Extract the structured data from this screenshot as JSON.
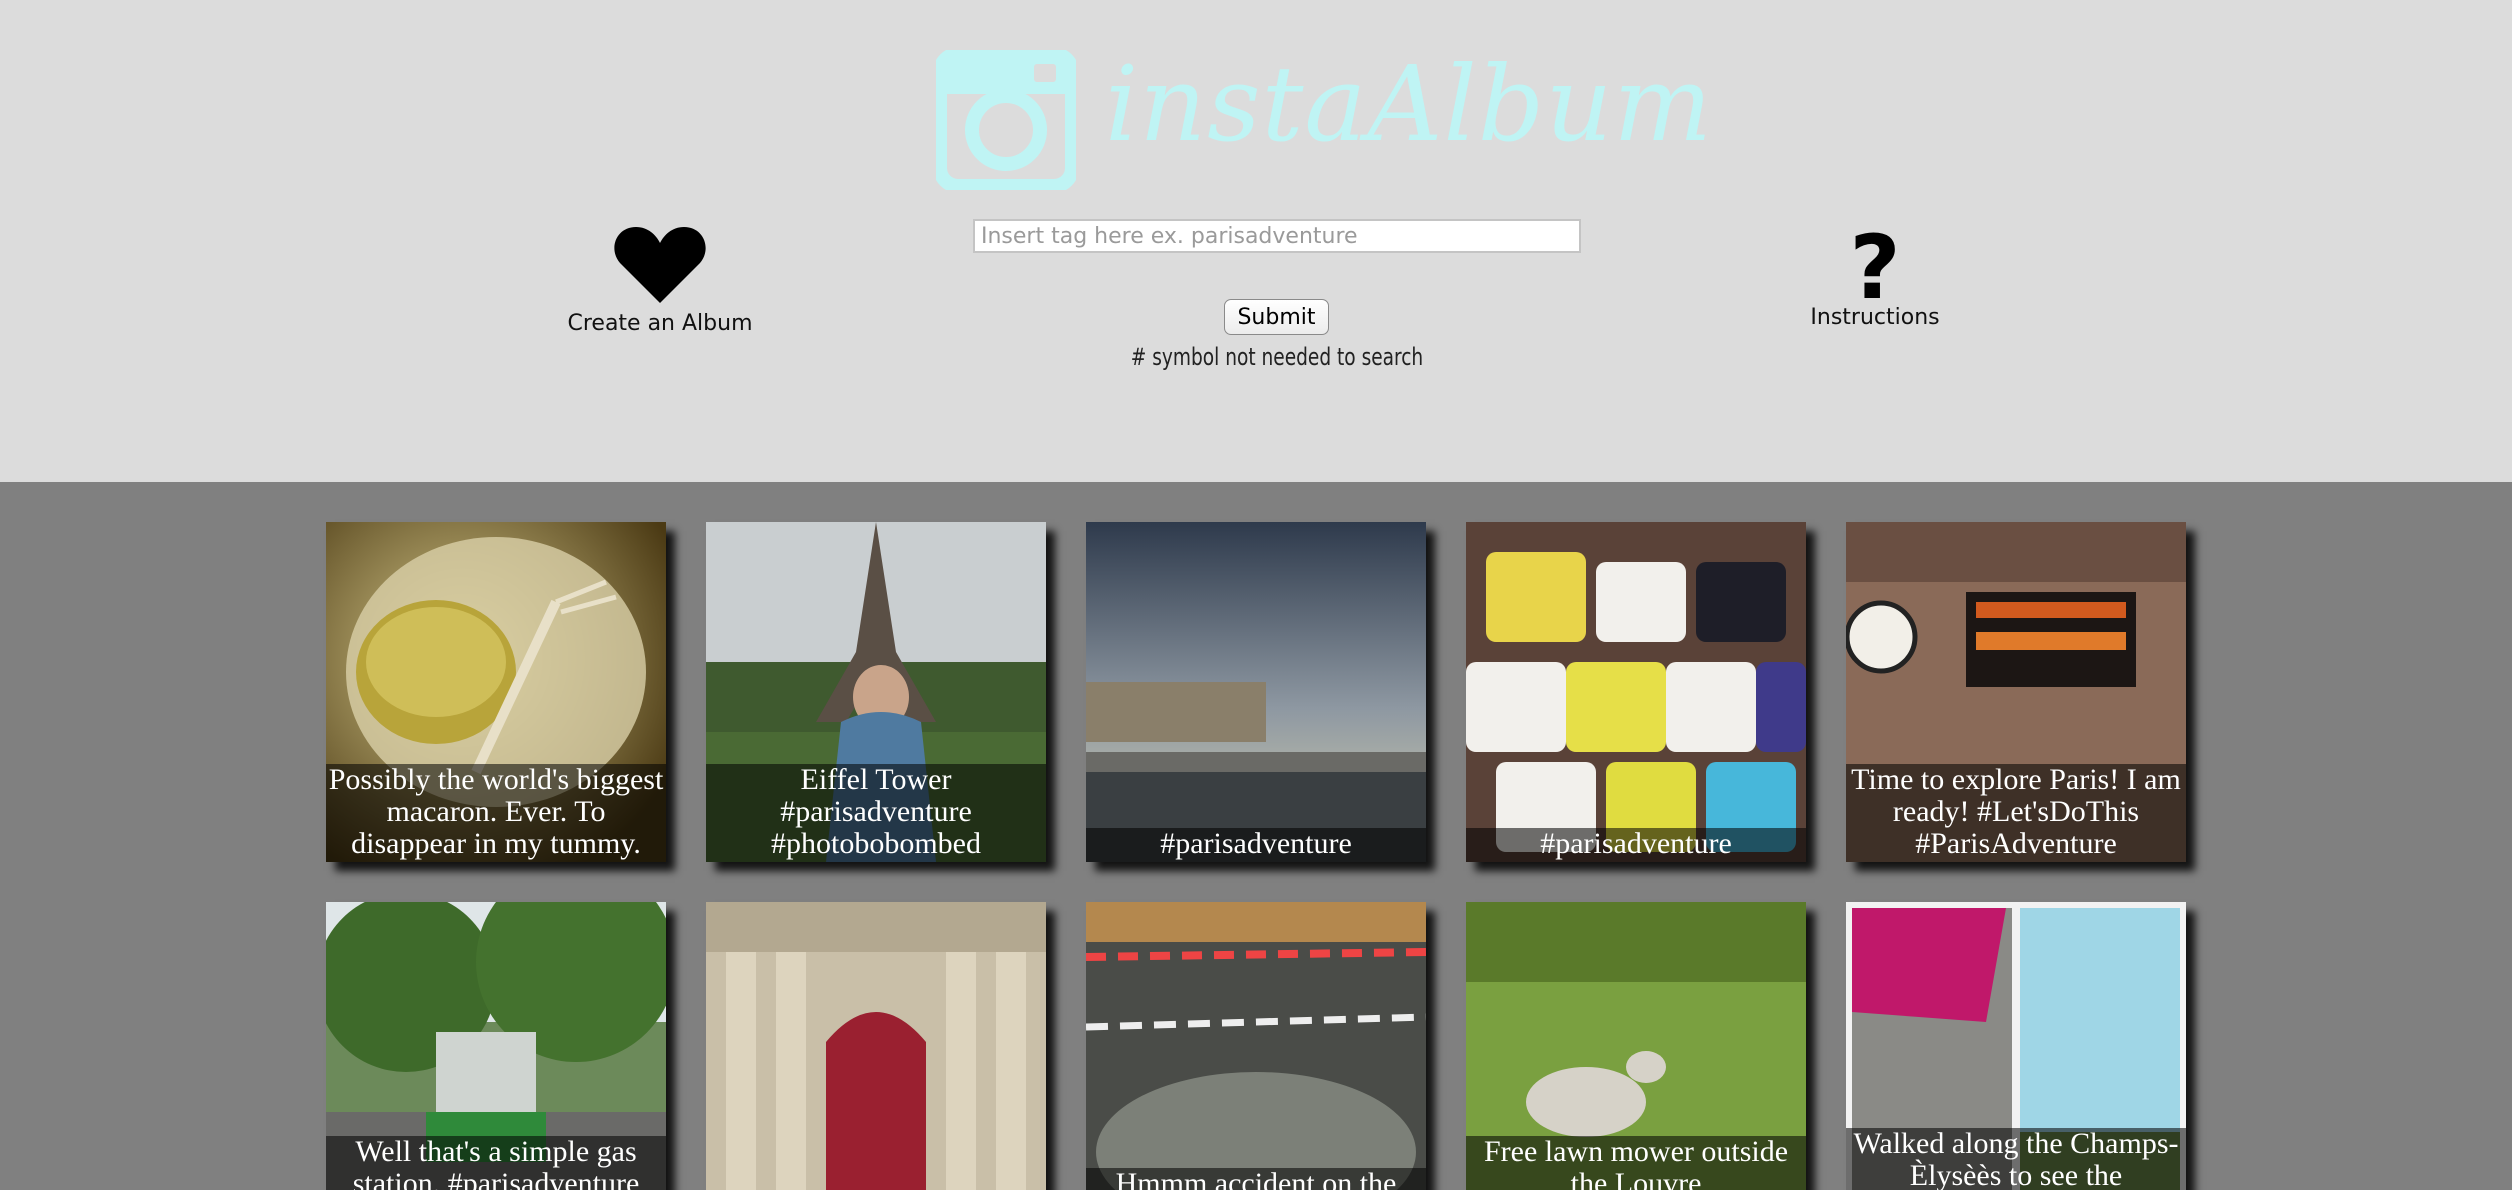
{
  "header": {
    "logo_text": "instaAlbum",
    "search": {
      "placeholder": "Insert tag here ex. parisadventure",
      "value": ""
    },
    "submit_label": "Submit",
    "hint": "# symbol not needed to search",
    "create_album": {
      "label": "Create an Album",
      "icon": "heart-icon"
    },
    "instructions": {
      "label": "Instructions",
      "icon": "question-mark-icon"
    }
  },
  "colors": {
    "logo": "#bff4f4",
    "header_bg": "#dcdcdc",
    "gallery_bg": "#808080"
  },
  "gallery": {
    "photos": [
      {
        "caption": "Possibly the world's biggest macaron. Ever. To disappear in my tummy."
      },
      {
        "caption": "Eiffel Tower #parisadventure #photobobombed"
      },
      {
        "caption": "#parisadventure"
      },
      {
        "caption": "#parisadventure"
      },
      {
        "caption": "Time to explore Paris! I am ready! #Let'sDoThis #ParisAdventure"
      },
      {
        "caption": "Well that's a simple gas station. #parisadventure"
      },
      {
        "caption": ""
      },
      {
        "caption": "Hmmm accident on the"
      },
      {
        "caption": "Free lawn mower outside the Louvre"
      },
      {
        "caption": "Walked along the Champs-Èlysèès to see the"
      }
    ]
  }
}
